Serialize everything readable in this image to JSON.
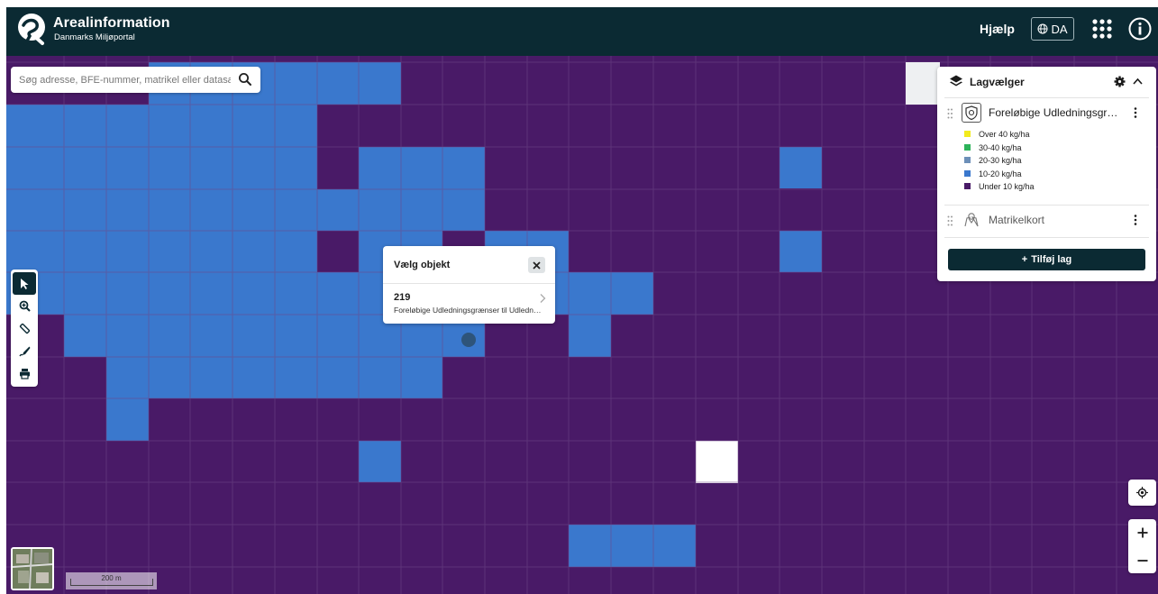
{
  "header": {
    "title": "Arealinformation",
    "subtitle": "Danmarks Miljøportal",
    "help_label": "Hjælp",
    "language_label": "DA"
  },
  "search": {
    "placeholder": "Søg adresse, BFE-nummer, matrikel eller datasæt"
  },
  "popup": {
    "title": "Vælg objekt",
    "item_id": "219",
    "item_description": "Foreløbige Udledningsgrænser til Udledningsgrænser til"
  },
  "layer_picker": {
    "title": "Lagvælger",
    "layers": [
      {
        "name": "Foreløbige Udledningsgrænser til",
        "legend": [
          {
            "label": "Over 40 kg/ha",
            "color": "#f2eb1d"
          },
          {
            "label": "30-40 kg/ha",
            "color": "#2db35a"
          },
          {
            "label": "20-30 kg/ha",
            "color": "#6c8fb8"
          },
          {
            "label": "10-20 kg/ha",
            "color": "#3a78cd"
          },
          {
            "label": "Under 10 kg/ha",
            "color": "#491a67"
          }
        ]
      },
      {
        "name": "Matrikelkort"
      }
    ],
    "add_layer_label": "Tilføj lag"
  },
  "scale": {
    "label": "200 m"
  },
  "colors": {
    "header_bg": "#0b2a33",
    "map_purple": "#491a67",
    "map_blue": "#3a78cd"
  },
  "icons": [
    "logo-icon",
    "globe-icon",
    "apps-grid-icon",
    "info-icon",
    "search-icon",
    "select-arrow-icon",
    "zoom-search-icon",
    "measure-icon",
    "draw-icon",
    "print-icon",
    "close-icon",
    "chevron-right-icon",
    "layers-icon",
    "gear-icon",
    "chevron-up-icon",
    "drag-handle-icon",
    "kebab-icon",
    "locate-icon",
    "plus-icon",
    "minus-icon"
  ]
}
